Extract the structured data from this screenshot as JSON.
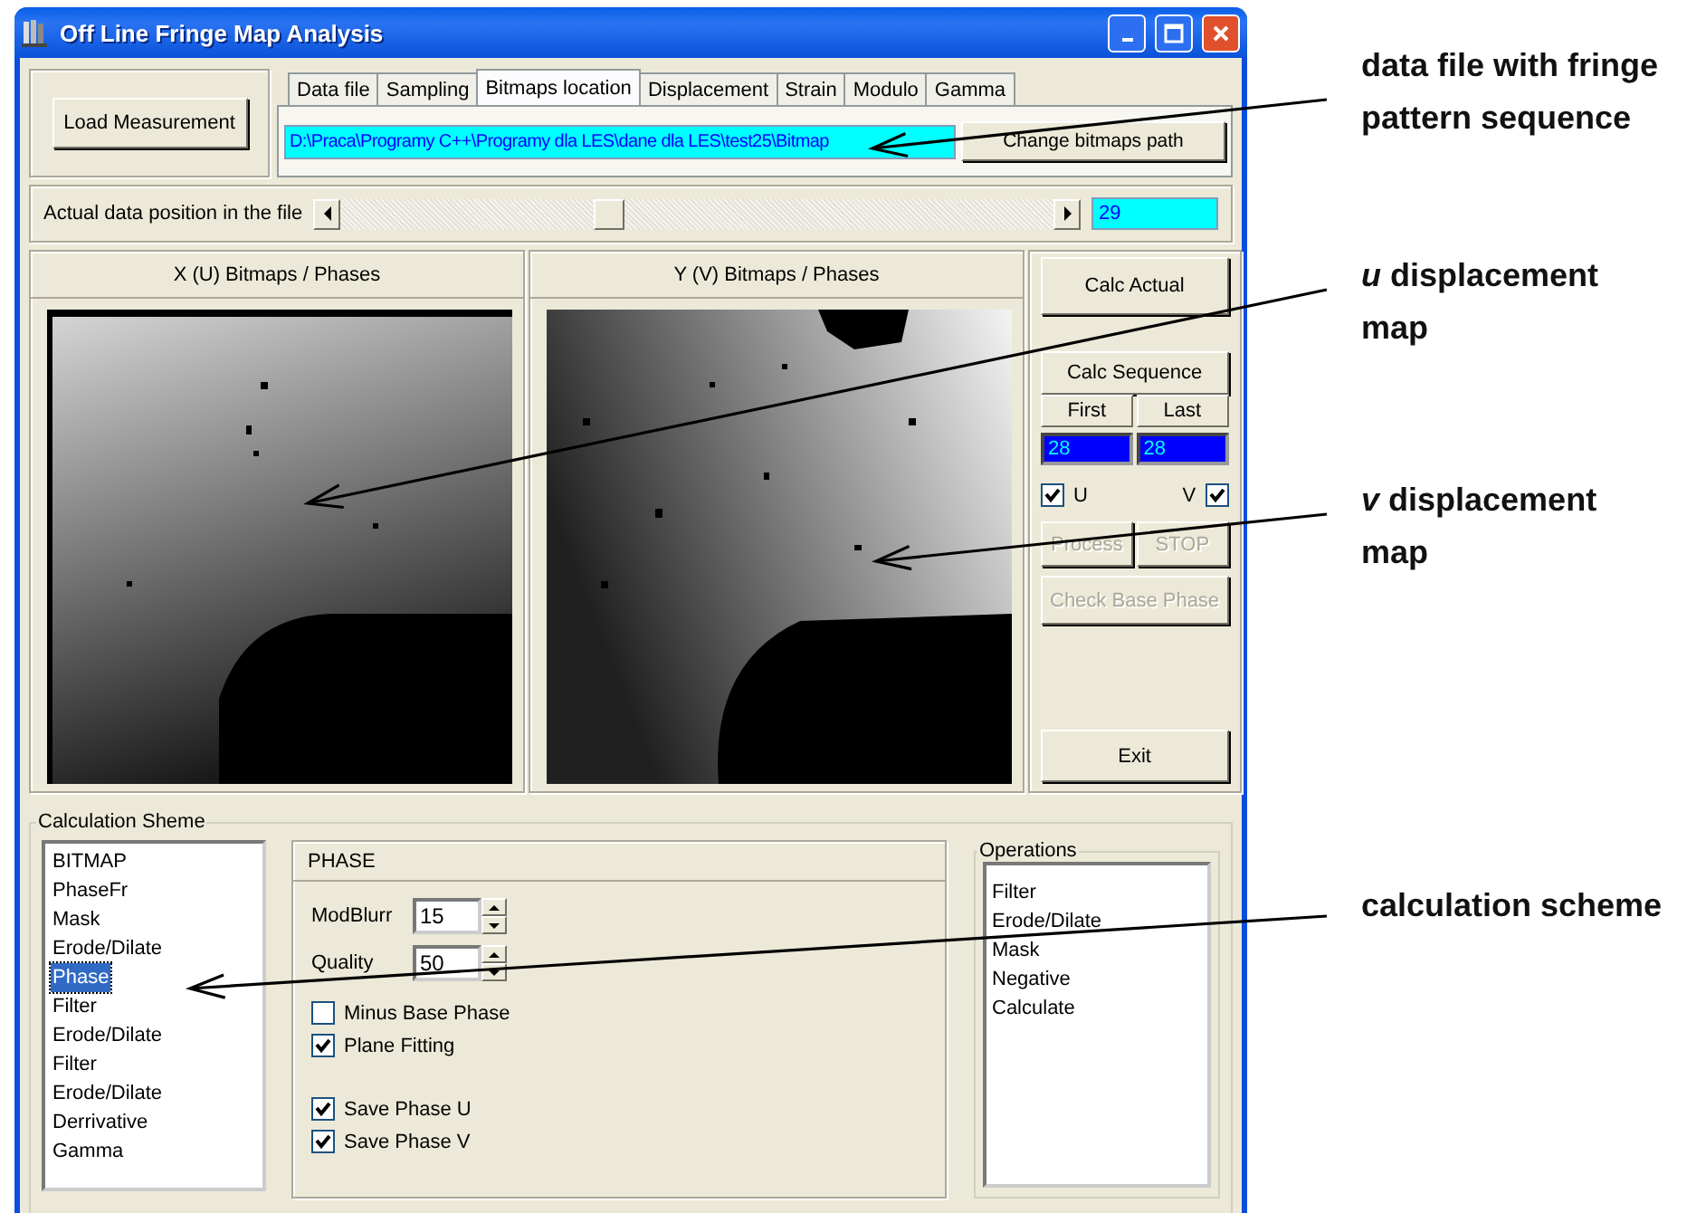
{
  "window": {
    "title": "Off Line Fringe Map Analysis"
  },
  "load_button": "Load Measurement",
  "tabs": [
    {
      "label": "Data file",
      "selected": false
    },
    {
      "label": "Sampling",
      "selected": false
    },
    {
      "label": "Bitmaps location",
      "selected": true
    },
    {
      "label": "Displacement",
      "selected": false
    },
    {
      "label": "Strain",
      "selected": false
    },
    {
      "label": "Modulo",
      "selected": false
    },
    {
      "label": "Gamma",
      "selected": false
    }
  ],
  "bitmaps_path": {
    "value": "D:\\Praca\\Programy C++\\Programy dla LES\\dane dla LES\\test25\\Bitmap"
  },
  "change_path_button": "Change bitmaps path",
  "position": {
    "label": "Actual data position in the file",
    "level": 0.37,
    "value": "29"
  },
  "image_panels": [
    {
      "title": "X (U) Bitmaps / Phases",
      "kind": "picture"
    },
    {
      "title": "Y (V) Bitmaps / Phases",
      "kind": "picture"
    }
  ],
  "controls": {
    "calc_actual": "Calc Actual",
    "calc_sequence": "Calc Sequence",
    "range": [
      {
        "label": "First",
        "value": "28"
      },
      {
        "label": "Last",
        "value": "28"
      }
    ],
    "checkboxes": [
      {
        "label": "U",
        "checked": true
      },
      {
        "label": "V",
        "checked": true
      }
    ],
    "buttons": [
      {
        "label": "Process",
        "disabled": true
      },
      {
        "label": "STOP",
        "disabled": true
      },
      {
        "label": "Check Base Phase",
        "disabled": true
      }
    ],
    "exit": "Exit"
  },
  "calculation_scheme": {
    "title": "Calculation Sheme",
    "steps": [
      {
        "label": "BITMAP",
        "selected": false
      },
      {
        "label": "PhaseFr",
        "selected": false
      },
      {
        "label": "Mask",
        "selected": false
      },
      {
        "label": "Erode/Dilate",
        "selected": false
      },
      {
        "label": "Phase",
        "selected": true
      },
      {
        "label": "Filter",
        "selected": false
      },
      {
        "label": "Erode/Dilate",
        "selected": false
      },
      {
        "label": "Filter",
        "selected": false
      },
      {
        "label": "Erode/Dilate",
        "selected": false
      },
      {
        "label": "Derrivative",
        "selected": false
      },
      {
        "label": "Gamma",
        "selected": false
      }
    ],
    "phase": {
      "title": "PHASE",
      "spinners": [
        {
          "label": "ModBlurr",
          "value": "15"
        },
        {
          "label": "Quality",
          "value": "50"
        }
      ],
      "option_groups": [
        [
          {
            "label": "Minus Base Phase",
            "checked": false
          },
          {
            "label": "Plane Fitting",
            "checked": true
          }
        ],
        [
          {
            "label": "Save Phase U",
            "checked": true
          },
          {
            "label": "Save Phase V",
            "checked": true
          }
        ]
      ]
    },
    "operations": {
      "title": "Operations",
      "items": [
        "Filter",
        "Erode/Dilate",
        "Mask",
        "Negative",
        "Calculate"
      ]
    }
  },
  "annotations": [
    {
      "text": "data file with fringe pattern sequence"
    },
    {
      "text": "*u* displacement map"
    },
    {
      "text": "*v* displacement map"
    },
    {
      "text": "calculation scheme"
    }
  ]
}
